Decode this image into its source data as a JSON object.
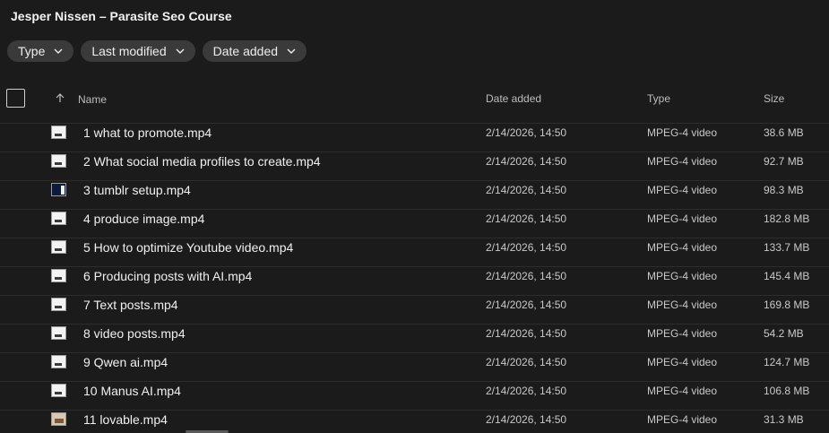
{
  "window": {
    "title": "Jesper Nissen – Parasite Seo Course"
  },
  "filters": [
    {
      "label": "Type"
    },
    {
      "label": "Last modified"
    },
    {
      "label": "Date added"
    }
  ],
  "columns": {
    "name": "Name",
    "date_added": "Date added",
    "type": "Type",
    "size": "Size"
  },
  "files": [
    {
      "name": "1 what to promote.mp4",
      "date_added": "2/14/2026, 14:50",
      "type": "MPEG-4 video",
      "size": "38.6 MB",
      "thumb": "light"
    },
    {
      "name": "2 What social media profiles to create.mp4",
      "date_added": "2/14/2026, 14:50",
      "type": "MPEG-4 video",
      "size": "92.7 MB",
      "thumb": "light"
    },
    {
      "name": "3 tumblr setup.mp4",
      "date_added": "2/14/2026, 14:50",
      "type": "MPEG-4 video",
      "size": "98.3 MB",
      "thumb": "dark"
    },
    {
      "name": "4 produce image.mp4",
      "date_added": "2/14/2026, 14:50",
      "type": "MPEG-4 video",
      "size": "182.8 MB",
      "thumb": "light"
    },
    {
      "name": "5 How to optimize Youtube video.mp4",
      "date_added": "2/14/2026, 14:50",
      "type": "MPEG-4 video",
      "size": "133.7 MB",
      "thumb": "light"
    },
    {
      "name": "6 Producing posts with AI.mp4",
      "date_added": "2/14/2026, 14:50",
      "type": "MPEG-4 video",
      "size": "145.4 MB",
      "thumb": "light"
    },
    {
      "name": "7 Text posts.mp4",
      "date_added": "2/14/2026, 14:50",
      "type": "MPEG-4 video",
      "size": "169.8 MB",
      "thumb": "light"
    },
    {
      "name": "8 video posts.mp4",
      "date_added": "2/14/2026, 14:50",
      "type": "MPEG-4 video",
      "size": "54.2 MB",
      "thumb": "light"
    },
    {
      "name": "9 Qwen ai.mp4",
      "date_added": "2/14/2026, 14:50",
      "type": "MPEG-4 video",
      "size": "124.7 MB",
      "thumb": "light"
    },
    {
      "name": "10 Manus AI.mp4",
      "date_added": "2/14/2026, 14:50",
      "type": "MPEG-4 video",
      "size": "106.8 MB",
      "thumb": "light"
    },
    {
      "name": "11 lovable.mp4",
      "date_added": "2/14/2026, 14:50",
      "type": "MPEG-4 video",
      "size": "31.3 MB",
      "thumb": "photo"
    }
  ],
  "icons": {
    "chevron": "chevron-down-icon",
    "sort": "arrow-up-icon",
    "thumbnail": "video-thumbnail-icon"
  },
  "colors": {
    "background": "#1b1b1b",
    "chip": "#3a3a3a",
    "divider": "#2c2c2c"
  }
}
